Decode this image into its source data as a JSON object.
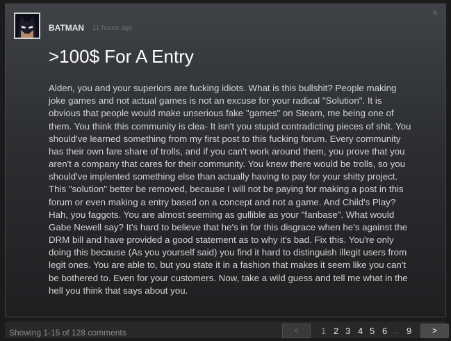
{
  "comment": {
    "author": "BATMAN",
    "timestamp": "11 hours ago",
    "title": ">100$ For A Entry",
    "body_lines": [
      "Alden, you and your superiors are fucking idiots. What is this bullshit? People making",
      "joke games and not actual games is not an excuse for your radical \"Solution\". It is",
      "obvious that people would make unserious fake \"games\" on Steam, me being one of",
      "them. You think this community is clea- It isn't you stupid contradicting pieces of shit. You",
      "should've learned something from my first post to this fucking forum. Every community",
      "has their own fare share of trolls, and if you can't work around them, you prove that you",
      "aren't a company that cares for their community. You knew there would be trolls, so you",
      "should've implented something else than actually having to pay for your shitty project.",
      "This \"solution\" better be removed, because I will not be paying for making a post in this",
      "forum or even making a entry based on a concept and not a game. And Child's Play?",
      "Hah, you faggots. You are almost seeming as gullible as your \"fanbase\". What would",
      "Gabe Newell say? It's hard to believe that he's in for this disgrace when he's against the",
      "DRM bill and have provided a good statement as to why it's bad. Fix this. You're only",
      "doing this because (As you yourself said) you find it hard to distinguish illegit users from",
      "legit ones. You are able to, but you state it in a fashion that makes it seem like you can't",
      "be bothered to. Even for your customers. Now, take a wild guess and tell me what in the",
      "hell you think that says about you."
    ]
  },
  "footer": {
    "summary": "Showing 1-15 of 128 comments",
    "prev_label": "<",
    "next_label": ">",
    "pages": [
      "1",
      "2",
      "3",
      "4",
      "5",
      "6",
      "...",
      "9"
    ],
    "current_page": "1"
  },
  "icons": {
    "close": "close-icon",
    "avatar": "batman-avatar"
  }
}
